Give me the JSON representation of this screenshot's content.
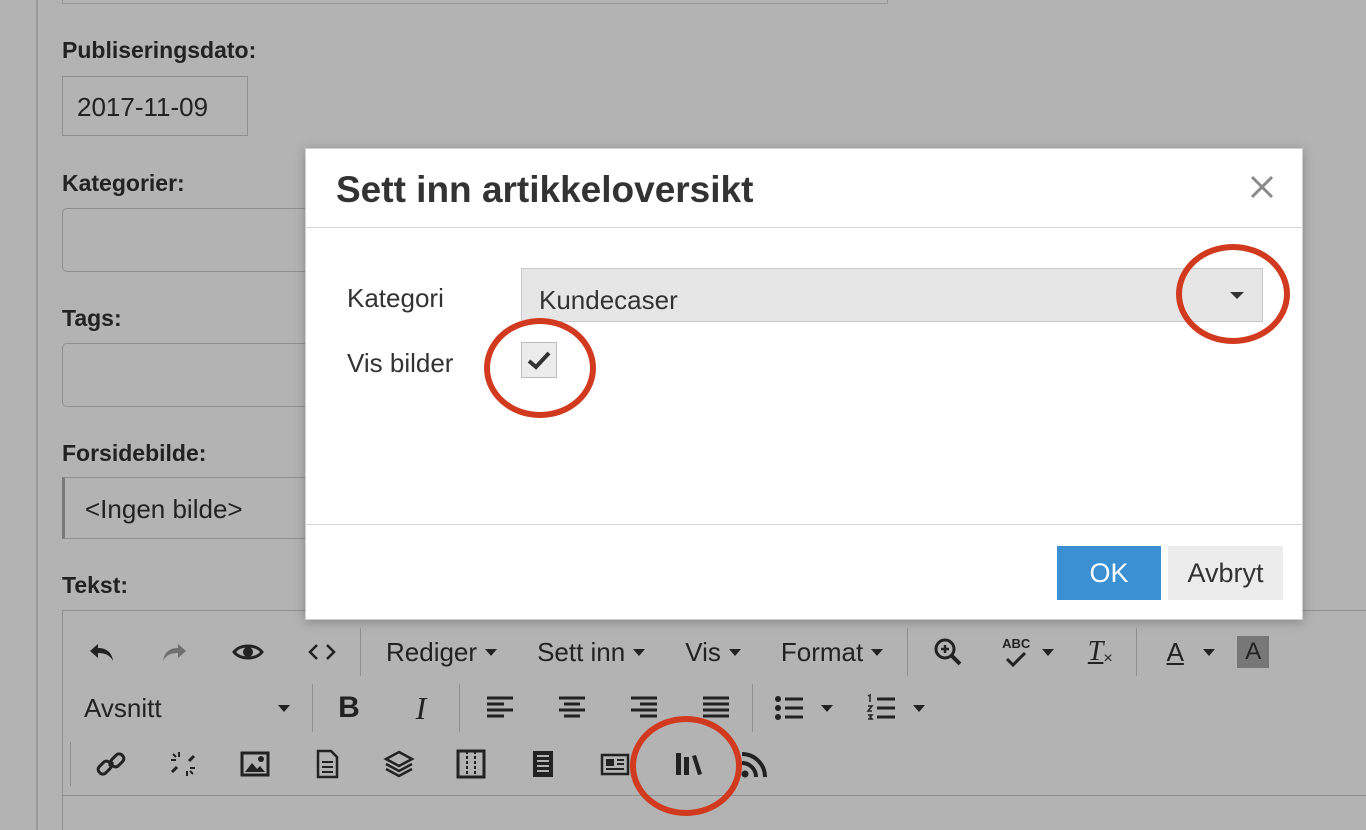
{
  "form": {
    "date_label": "Publiseringsdato:",
    "date_value": "2017-11-09",
    "categories_label": "Kategorier:",
    "tags_label": "Tags:",
    "cover_label": "Forsidebilde:",
    "cover_value": "<Ingen bilde>",
    "text_label": "Tekst:"
  },
  "toolbar": {
    "menus": [
      "Rediger",
      "Sett inn",
      "Vis",
      "Format"
    ],
    "block_format": "Avsnitt",
    "spellcheck_label": "ABC",
    "bold_label": "B",
    "italic_label": "I",
    "font_color_label": "A",
    "bg_color_label": "A",
    "clear_format_label": "T"
  },
  "modal": {
    "title": "Sett inn artikkeloversikt",
    "category_label": "Kategori",
    "category_value": "Kundecaser",
    "show_images_label": "Vis bilder",
    "show_images_checked": true,
    "ok_label": "OK",
    "cancel_label": "Avbryt"
  },
  "colors": {
    "primary": "#3b8fd3",
    "annotation": "#d13a1e",
    "overlay_bg": "#b3b3b3"
  }
}
